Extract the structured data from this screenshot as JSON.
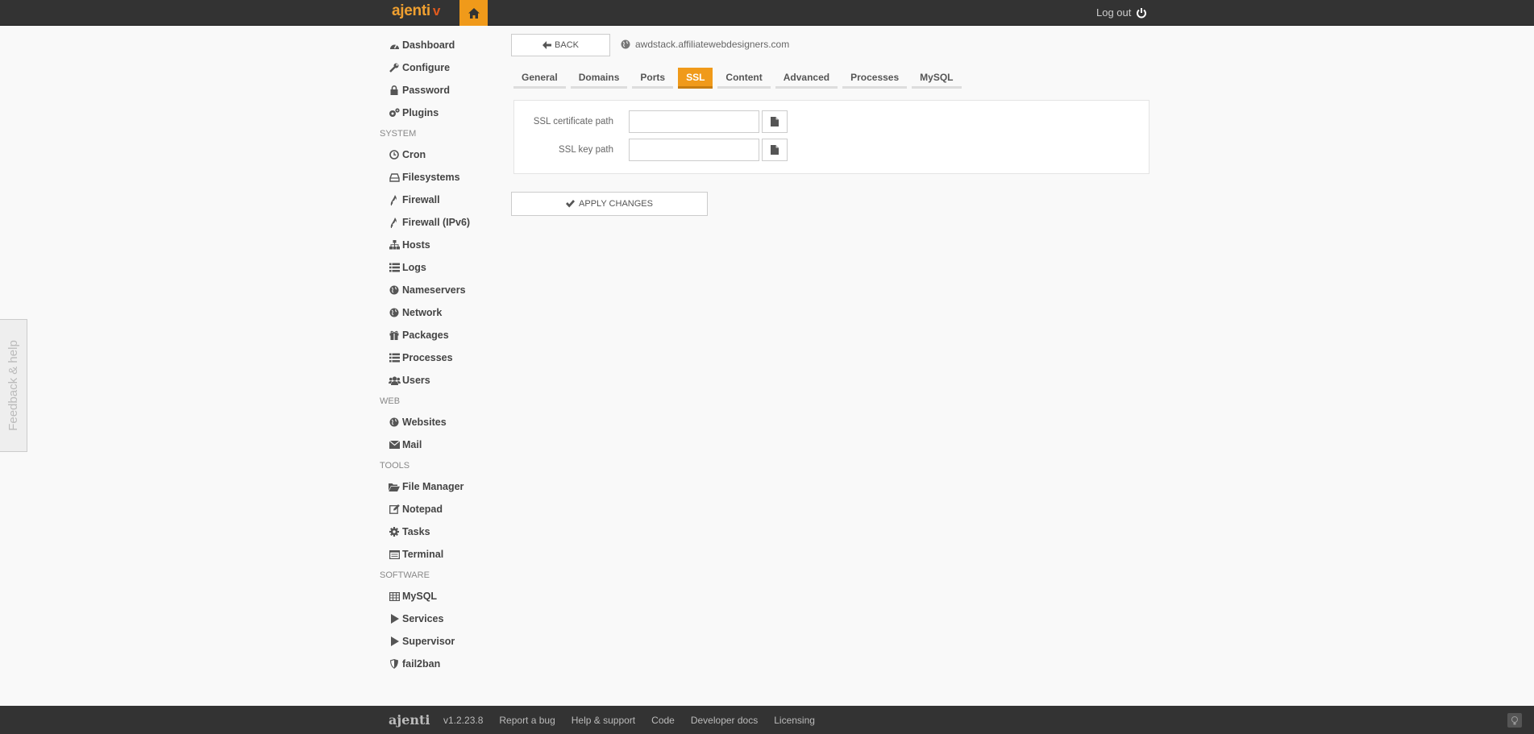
{
  "header": {
    "brand": "ajenti",
    "brand_version_mark": "v",
    "logout_label": "Log out"
  },
  "sidebar": {
    "top_items": [
      {
        "label": "Dashboard",
        "icon": "dashboard-icon"
      },
      {
        "label": "Configure",
        "icon": "wrench-icon"
      },
      {
        "label": "Password",
        "icon": "lock-icon"
      },
      {
        "label": "Plugins",
        "icon": "gears-icon"
      }
    ],
    "sections": [
      {
        "title": "SYSTEM",
        "items": [
          {
            "label": "Cron",
            "icon": "clock-icon"
          },
          {
            "label": "Filesystems",
            "icon": "hdd-icon"
          },
          {
            "label": "Firewall",
            "icon": "fire-icon"
          },
          {
            "label": "Firewall (IPv6)",
            "icon": "fire-icon"
          },
          {
            "label": "Hosts",
            "icon": "sitemap-icon"
          },
          {
            "label": "Logs",
            "icon": "list-icon"
          },
          {
            "label": "Nameservers",
            "icon": "globe-icon"
          },
          {
            "label": "Network",
            "icon": "globe-icon"
          },
          {
            "label": "Packages",
            "icon": "gift-icon"
          },
          {
            "label": "Processes",
            "icon": "list-icon"
          },
          {
            "label": "Users",
            "icon": "group-icon"
          }
        ]
      },
      {
        "title": "WEB",
        "items": [
          {
            "label": "Websites",
            "icon": "globe-icon"
          },
          {
            "label": "Mail",
            "icon": "envelope-icon"
          }
        ]
      },
      {
        "title": "TOOLS",
        "items": [
          {
            "label": "File Manager",
            "icon": "folder-open-icon"
          },
          {
            "label": "Notepad",
            "icon": "edit-icon"
          },
          {
            "label": "Tasks",
            "icon": "gear-icon"
          },
          {
            "label": "Terminal",
            "icon": "terminal-icon"
          }
        ]
      },
      {
        "title": "SOFTWARE",
        "items": [
          {
            "label": "MySQL",
            "icon": "table-icon"
          },
          {
            "label": "Services",
            "icon": "play-icon"
          },
          {
            "label": "Supervisor",
            "icon": "play-icon"
          },
          {
            "label": "fail2ban",
            "icon": "shield-icon"
          }
        ]
      }
    ]
  },
  "main": {
    "back_label": "BACK",
    "site_name": "awdstack.affiliatewebdesigners.com",
    "tabs": [
      {
        "label": "General",
        "active": false
      },
      {
        "label": "Domains",
        "active": false
      },
      {
        "label": "Ports",
        "active": false
      },
      {
        "label": "SSL",
        "active": true
      },
      {
        "label": "Content",
        "active": false
      },
      {
        "label": "Advanced",
        "active": false
      },
      {
        "label": "Processes",
        "active": false
      },
      {
        "label": "MySQL",
        "active": false
      }
    ],
    "fields": {
      "cert_label": "SSL certificate path",
      "cert_value": "",
      "key_label": "SSL key path",
      "key_value": ""
    },
    "apply_label": "APPLY CHANGES"
  },
  "feedback_label": "Feedback & help",
  "footer": {
    "logo": "ajenti",
    "version": "v1.2.23.8",
    "links": [
      "Report a bug",
      "Help & support",
      "Code",
      "Developer docs",
      "Licensing"
    ]
  },
  "colors": {
    "accent": "#f09a1a",
    "topbar": "#333333",
    "background": "#f9f9f9"
  }
}
